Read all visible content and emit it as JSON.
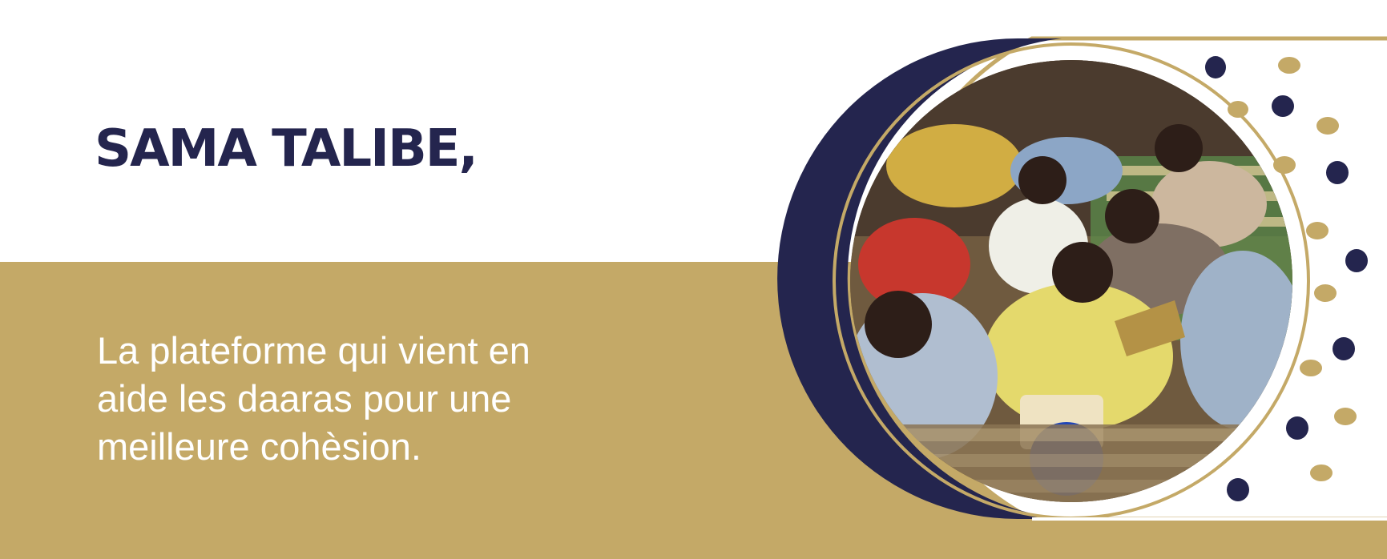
{
  "banner": {
    "title": "SAMA TALIBE,",
    "tagline": "La plateforme qui vient  en\naide les daaras pour  une\nmeilleure cohèsion."
  },
  "colors": {
    "navy": "#24254e",
    "gold": "#c4a967",
    "white": "#ffffff",
    "photo_dark": "#4b3b2e",
    "photo_mid": "#7a6549",
    "shirt_yellow": "#e4d96c",
    "shirt_blue": "#9fb2c8",
    "mat_green": "#5b8e4c",
    "bucket_blue": "#2146b8"
  },
  "icons": {
    "photo": "children-reading-photo-icon",
    "pattern": "dot-pattern-icon"
  }
}
